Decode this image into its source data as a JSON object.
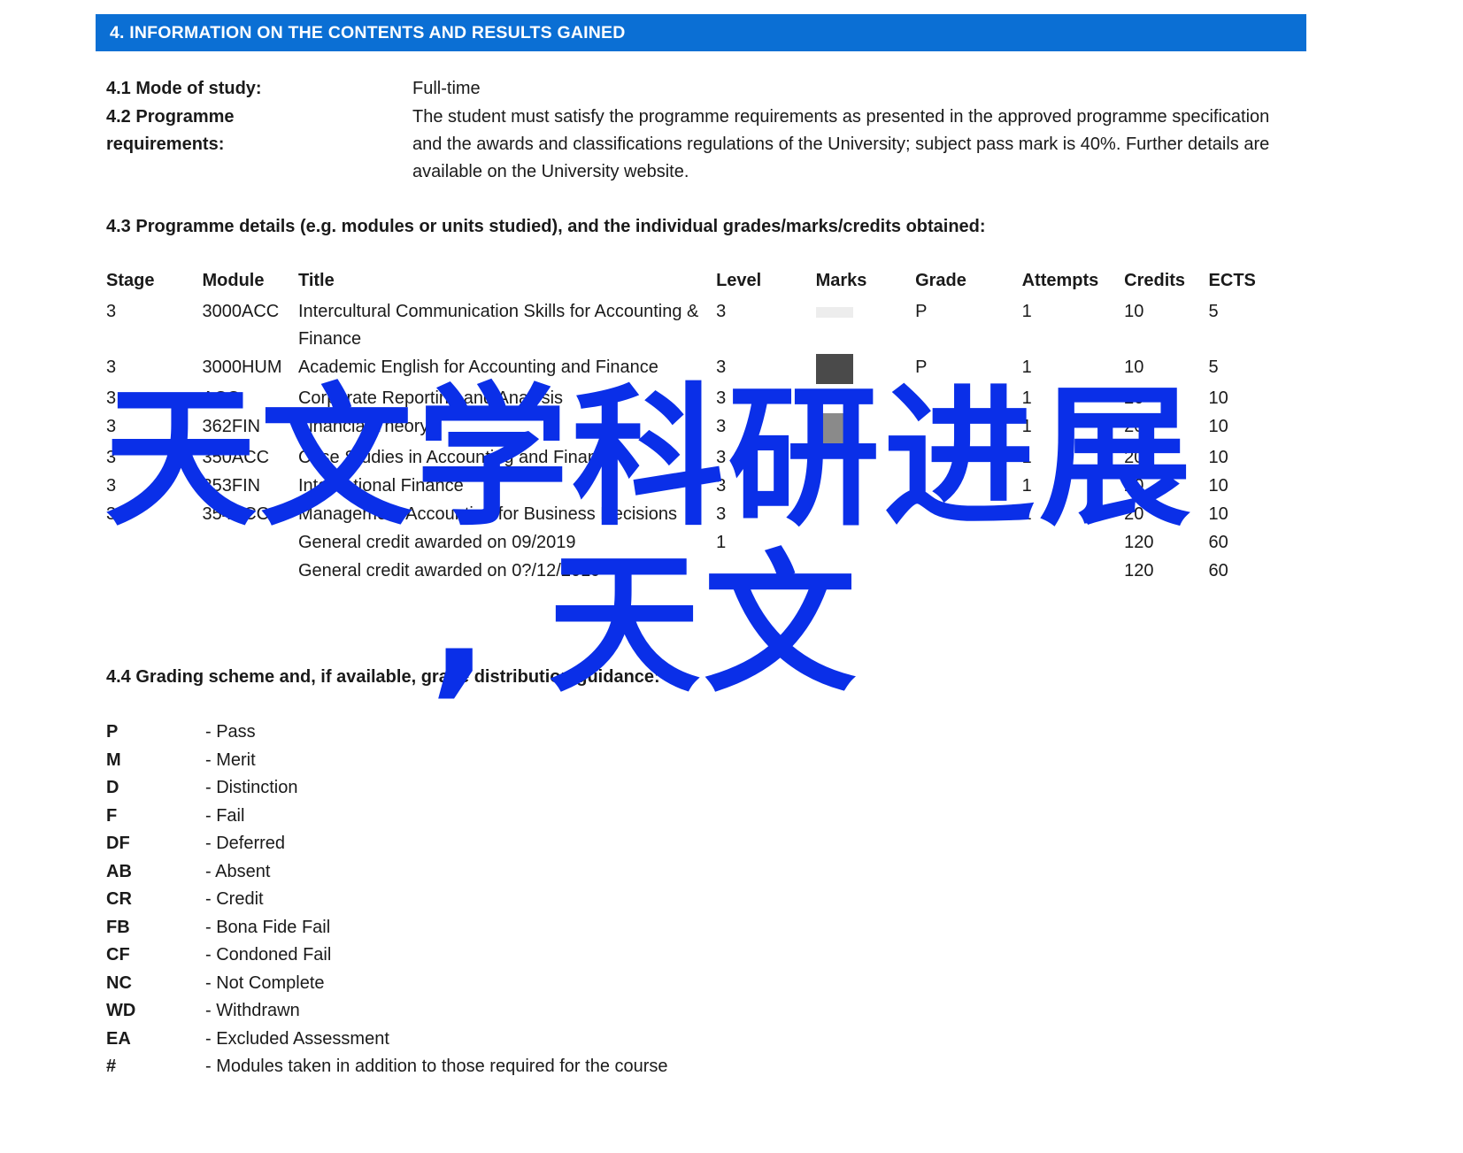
{
  "document": {
    "section_banner": "4. INFORMATION ON THE CONTENTS AND RESULTS GAINED",
    "banner_color": "#0b6fd4",
    "fields": [
      {
        "number_label": "4.1 Mode of study:",
        "value": "Full-time"
      },
      {
        "number_label": "4.2 Programme\nrequirements:",
        "value": "The student must satisfy the programme requirements as presented in the approved programme specification and the awards and classifications regulations of the University; subject pass mark is 40%. Further details are available on the University website."
      }
    ],
    "section_4_3_heading": "4.3 Programme details (e.g. modules or units studied), and the individual grades/marks/credits obtained:",
    "section_4_4_heading": "4.4 Grading scheme and, if available, grade distribution guidance:",
    "modules_table": {
      "columns": [
        "Stage",
        "Module",
        "Title",
        "Level",
        "Marks",
        "Grade",
        "Attempts",
        "Credits",
        "ECTS"
      ],
      "rows": [
        {
          "stage": "3",
          "module": "3000ACC",
          "title": "Intercultural Communication Skills for Accounting & Finance",
          "level": "3",
          "marks": "",
          "marks_redaction": "faint",
          "grade": "P",
          "attempts": "1",
          "credits": "10",
          "ects": "5"
        },
        {
          "stage": "3",
          "module": "3000HUM",
          "title": "Academic English for Accounting and Finance",
          "level": "3",
          "marks": "",
          "marks_redaction": "dark",
          "grade": "P",
          "attempts": "1",
          "credits": "10",
          "ects": "5"
        },
        {
          "stage": "3",
          "module": "ACC",
          "title": "Corporate Reporting and Analysis",
          "level": "3",
          "marks": "",
          "marks_redaction": "none",
          "grade": "",
          "attempts": "1",
          "credits": "20",
          "ects": "10"
        },
        {
          "stage": "3",
          "module": "362FIN",
          "title": "Financial Theory",
          "level": "3",
          "marks": "",
          "marks_redaction": "mid",
          "grade": "",
          "attempts": "1",
          "credits": "20",
          "ects": "10"
        },
        {
          "stage": "3",
          "module": "350ACC",
          "title": "Case Studies in Accounting and Finance",
          "level": "3",
          "marks": "",
          "marks_redaction": "none",
          "grade": "",
          "attempts": "1",
          "credits": "20",
          "ects": "10"
        },
        {
          "stage": "3",
          "module": "353FIN",
          "title": "International Finance",
          "level": "3",
          "marks": "",
          "marks_redaction": "none",
          "grade": "",
          "attempts": "1",
          "credits": "20",
          "ects": "10"
        },
        {
          "stage": "3",
          "module": "354ACC",
          "title": "Management Accounting for Business Decisions",
          "level": "3",
          "marks": "",
          "marks_redaction": "none",
          "grade": "",
          "attempts": "1",
          "credits": "20",
          "ects": "10"
        },
        {
          "stage": "",
          "module": "",
          "title": "General credit awarded on 09/2019",
          "level": "1",
          "marks": "",
          "marks_redaction": "none",
          "grade": "",
          "attempts": "",
          "credits": "120",
          "ects": "60"
        },
        {
          "stage": "",
          "module": "",
          "title": "General credit awarded on 0?/12/2019",
          "level": "",
          "marks": "",
          "marks_redaction": "none",
          "grade": "",
          "attempts": "",
          "credits": "120",
          "ects": "60"
        }
      ]
    },
    "grading_legend": [
      {
        "code": "P",
        "description": "- Pass"
      },
      {
        "code": "M",
        "description": "- Merit"
      },
      {
        "code": "D",
        "description": "- Distinction"
      },
      {
        "code": "F",
        "description": "- Fail"
      },
      {
        "code": "DF",
        "description": "- Deferred"
      },
      {
        "code": "AB",
        "description": "- Absent"
      },
      {
        "code": "CR",
        "description": "- Credit"
      },
      {
        "code": "FB",
        "description": "- Bona Fide Fail"
      },
      {
        "code": "CF",
        "description": "- Condoned Fail"
      },
      {
        "code": "NC",
        "description": "- Not Complete"
      },
      {
        "code": "WD",
        "description": "- Withdrawn"
      },
      {
        "code": "EA",
        "description": "- Excluded Assessment"
      },
      {
        "code": "#",
        "description": "- Modules taken in addition to those required for the course"
      }
    ]
  },
  "watermark": {
    "color": "#0a2fe8",
    "line1": "天文学科研进展",
    "line2": ", 天文"
  }
}
